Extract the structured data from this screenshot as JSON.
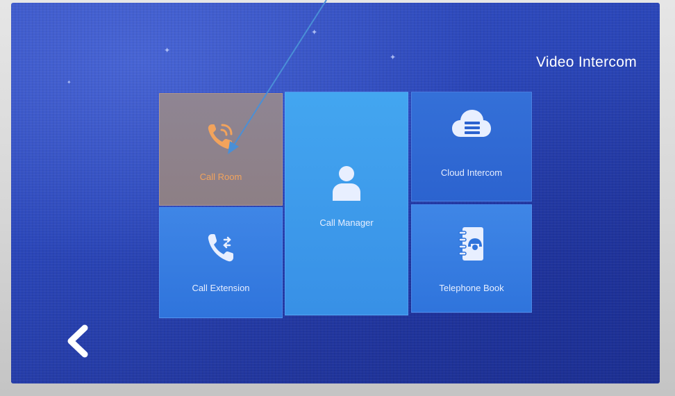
{
  "app": {
    "title": "Video Intercom"
  },
  "tiles": {
    "call_room": {
      "label": "Call Room",
      "icon": "phone-ringing-icon"
    },
    "call_manager": {
      "label": "Call Manager",
      "icon": "person-icon"
    },
    "cloud_intercom": {
      "label": "Cloud Intercom",
      "icon": "cloud-server-icon"
    },
    "call_extension": {
      "label": "Call Extension",
      "icon": "phone-transfer-icon"
    },
    "telephone_book": {
      "label": "Telephone Book",
      "icon": "phonebook-icon"
    }
  },
  "nav": {
    "back_icon": "chevron-left-icon"
  },
  "colors": {
    "tile_blue": "#2f74dc",
    "tile_selected": "#8f8593",
    "selected_accent": "#f2a35c",
    "arrow": "#4a8fd6"
  }
}
